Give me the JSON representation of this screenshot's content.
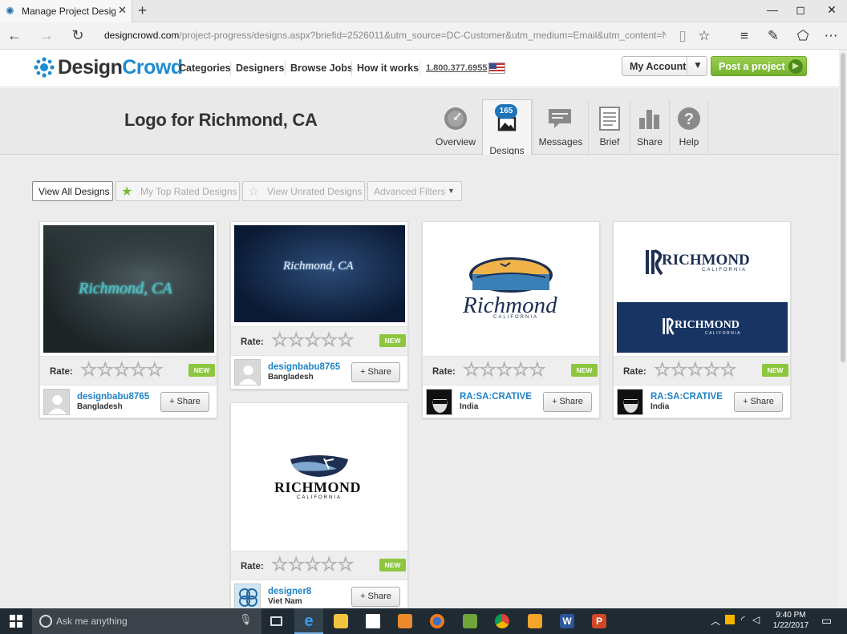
{
  "browser": {
    "tab_title": "Manage Project Design",
    "tab_close": "✕",
    "new_tab": "+",
    "url_domain": "designcrowd.com",
    "url_rest": "/project-progress/designs.aspx?briefid=2526011&utm_source=DC-Customer&utm_medium=Email&utm_content=New-design-",
    "min": "—",
    "max": "◻",
    "close": "✕"
  },
  "site": {
    "logo_a": "Design",
    "logo_b": "Crowd",
    "nav": [
      "Categories",
      "Designers",
      "Browse Jobs",
      "How it works"
    ],
    "phone": "1.800.377.6955",
    "account": "My Account",
    "post": "Post a project"
  },
  "project": {
    "title": "Logo for Richmond, CA",
    "badge": "165",
    "tabs": [
      "Overview",
      "Designs",
      "Messages",
      "Brief",
      "Share",
      "Help"
    ]
  },
  "filters": [
    "View All Designs",
    "My Top Rated Designs",
    "View Unrated Designs",
    "Advanced Filters"
  ],
  "rate_label": "Rate:",
  "new_label": "NEW",
  "share_label": "+ Share",
  "stars": "☆☆☆☆☆",
  "cards": [
    {
      "name": "designbabu8765",
      "country": "Bangladesh",
      "image_text": "Richmond, CA"
    },
    {
      "name": "designbabu8765",
      "country": "Bangladesh",
      "image_text": "Richmond, CA"
    },
    {
      "name": "RA:SA:CRATIVE",
      "country": "India",
      "image_text": "Richmond",
      "image_sub": "CALIFORNIA"
    },
    {
      "name": "RA:SA:CRATIVE",
      "country": "India",
      "image_text": "RICHMOND",
      "image_sub": "CALIFORNIA"
    },
    {
      "name": "designer8",
      "country": "Viet Nam",
      "image_text": "RICHMOND",
      "image_sub": "CALIFORNIA"
    }
  ],
  "taskbar": {
    "search": "Ask me anything",
    "time": "9:40 PM",
    "date": "1/22/2017"
  }
}
